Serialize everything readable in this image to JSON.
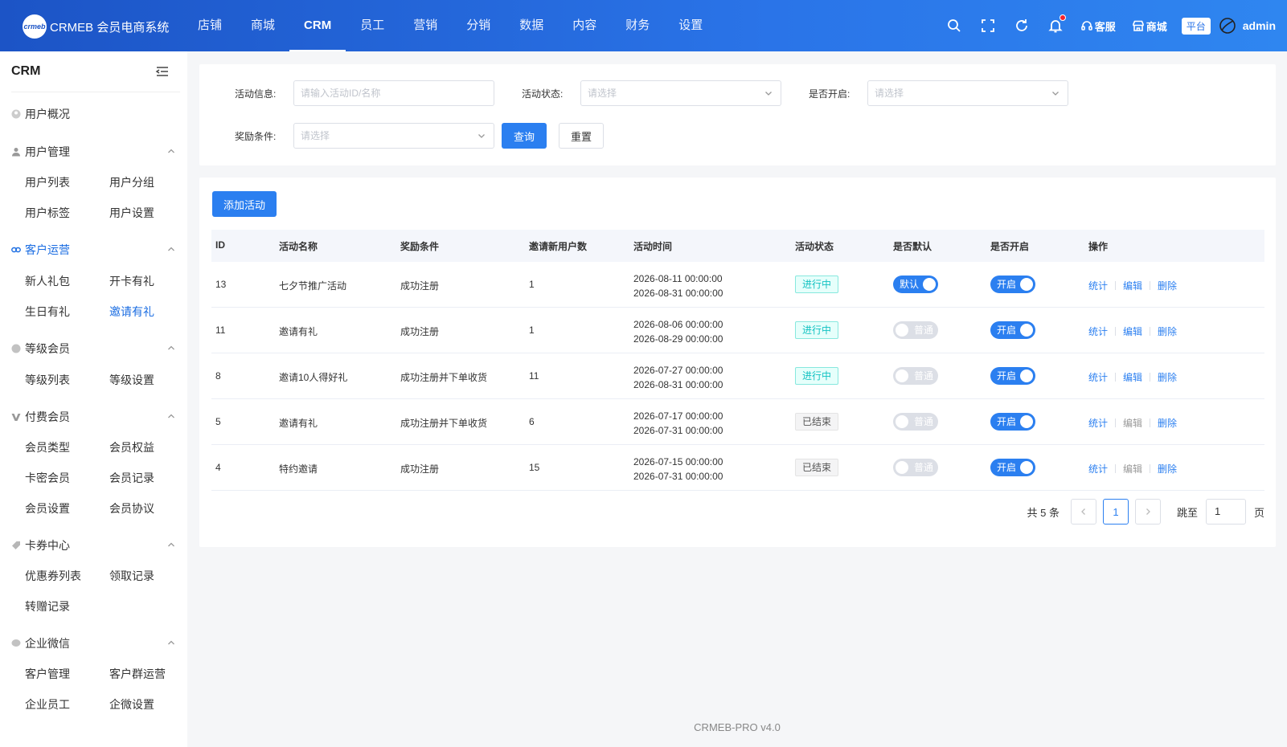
{
  "header": {
    "logo_badge": "crmeb",
    "logo_text": "CRMEB 会员电商系统",
    "nav": [
      "店铺",
      "商城",
      "CRM",
      "员工",
      "营销",
      "分销",
      "数据",
      "内容",
      "财务",
      "设置"
    ],
    "active_nav": "CRM",
    "service_label": "客服",
    "mall_label": "商城",
    "platform_tag": "平台",
    "admin_name": "admin"
  },
  "sidebar": {
    "title": "CRM",
    "overview": "用户概况",
    "groups": {
      "user_mgmt": {
        "label": "用户管理",
        "items": [
          "用户列表",
          "用户分组",
          "用户标签",
          "用户设置"
        ]
      },
      "customer_ops": {
        "label": "客户运营",
        "items": [
          "新人礼包",
          "开卡有礼",
          "生日有礼",
          "邀请有礼"
        ]
      },
      "level": {
        "label": "等级会员",
        "items": [
          "等级列表",
          "等级设置"
        ]
      },
      "paid": {
        "label": "付费会员",
        "items": [
          "会员类型",
          "会员权益",
          "卡密会员",
          "会员记录",
          "会员设置",
          "会员协议"
        ]
      },
      "coupon": {
        "label": "卡券中心",
        "items": [
          "优惠券列表",
          "领取记录",
          "转赠记录"
        ]
      },
      "wecom": {
        "label": "企业微信",
        "items": [
          "客户管理",
          "客户群运营",
          "企业员工",
          "企微设置"
        ]
      }
    }
  },
  "filters": {
    "activity_info_label": "活动信息:",
    "activity_info_placeholder": "请输入活动ID/名称",
    "activity_status_label": "活动状态:",
    "activity_status_placeholder": "请选择",
    "enabled_label": "是否开启:",
    "enabled_placeholder": "请选择",
    "reward_label": "奖励条件:",
    "reward_placeholder": "请选择",
    "query_btn": "查询",
    "reset_btn": "重置"
  },
  "table": {
    "add_btn": "添加活动",
    "columns": [
      "ID",
      "活动名称",
      "奖励条件",
      "邀请新用户数",
      "活动时间",
      "活动状态",
      "是否默认",
      "是否开启",
      "操作"
    ],
    "rows": [
      {
        "id": "13",
        "name": "七夕节推广活动",
        "condition": "成功注册",
        "count": "1",
        "start": "2026-08-11 00:00:00",
        "end": "2026-08-31 00:00:00",
        "status": "进行中",
        "default": "默认",
        "enabled": "开启"
      },
      {
        "id": "11",
        "name": "邀请有礼",
        "condition": "成功注册",
        "count": "1",
        "start": "2026-08-06 00:00:00",
        "end": "2026-08-29 00:00:00",
        "status": "进行中",
        "default": "普通",
        "enabled": "开启"
      },
      {
        "id": "8",
        "name": "邀请10人得好礼",
        "condition": "成功注册并下单收货",
        "count": "11",
        "start": "2026-07-27 00:00:00",
        "end": "2026-08-31 00:00:00",
        "status": "进行中",
        "default": "普通",
        "enabled": "开启"
      },
      {
        "id": "5",
        "name": "邀请有礼",
        "condition": "成功注册并下单收货",
        "count": "6",
        "start": "2026-07-17 00:00:00",
        "end": "2026-07-31 00:00:00",
        "status": "已结束",
        "default": "普通",
        "enabled": "开启"
      },
      {
        "id": "4",
        "name": "特约邀请",
        "condition": "成功注册",
        "count": "15",
        "start": "2026-07-15 00:00:00",
        "end": "2026-07-31 00:00:00",
        "status": "已结束",
        "default": "普通",
        "enabled": "开启"
      }
    ],
    "ops": {
      "stats": "统计",
      "edit": "编辑",
      "delete": "删除"
    }
  },
  "pagination": {
    "total_text": "共 5 条",
    "current_page": "1",
    "jump_label": "跳至",
    "jump_value": "1",
    "page_unit": "页"
  },
  "footer": "CRMEB-PRO v4.0",
  "colors": {
    "primary": "#2b7ff0",
    "header_start": "#1c54c6",
    "header_end": "#2f86f0",
    "status_going": "#13c2c2"
  }
}
